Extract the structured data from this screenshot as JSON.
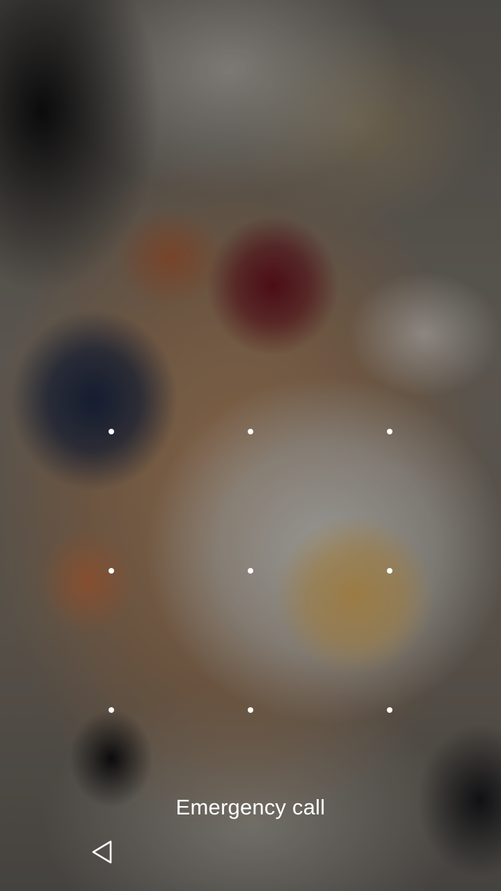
{
  "lock_screen": {
    "emergency_call_label": "Emergency call",
    "pattern_dots": [
      {
        "row": 1,
        "col": 1
      },
      {
        "row": 1,
        "col": 2
      },
      {
        "row": 1,
        "col": 3
      },
      {
        "row": 2,
        "col": 1
      },
      {
        "row": 2,
        "col": 2
      },
      {
        "row": 2,
        "col": 3
      },
      {
        "row": 3,
        "col": 1
      },
      {
        "row": 3,
        "col": 2
      },
      {
        "row": 3,
        "col": 3
      }
    ]
  },
  "navigation_bar": {
    "back_icon": "back-triangle-icon"
  },
  "colors": {
    "text": "#ffffff",
    "dot": "#ffffff"
  }
}
